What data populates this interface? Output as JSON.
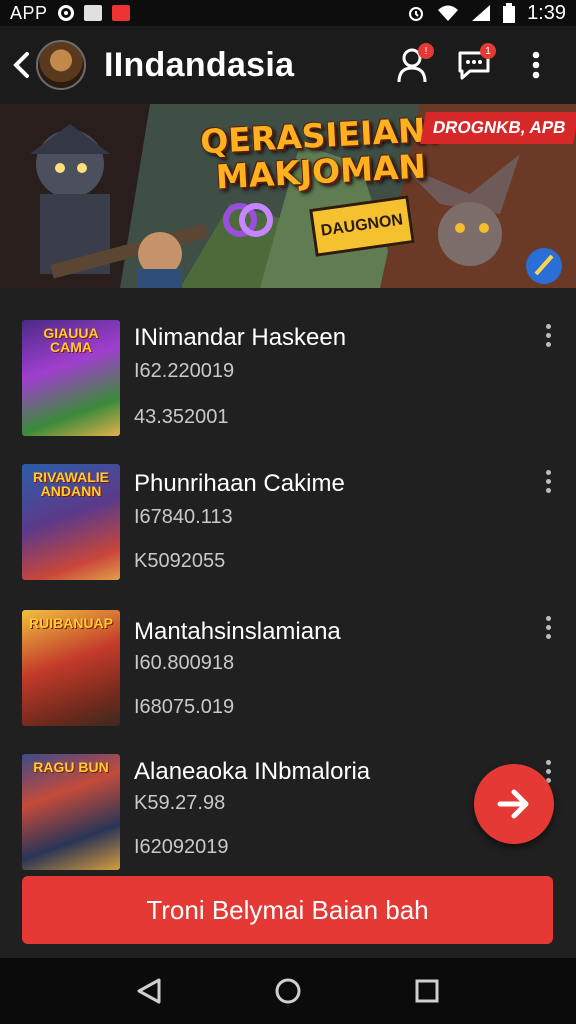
{
  "status_bar": {
    "app_label": "APP",
    "time": "1:39",
    "icons": [
      "record-icon",
      "image-icon",
      "red-app-icon",
      "alarm-icon",
      "wifi-icon",
      "signal-icon",
      "battery-icon"
    ]
  },
  "app_bar": {
    "title": "IIndandasia",
    "icons": [
      "back-icon",
      "avatar",
      "profile-icon",
      "chat-icon",
      "more-vert-icon"
    ],
    "profile_badge": "!",
    "chat_badge": "1"
  },
  "banner": {
    "title": "QERASIEIANI MAKJOMAN",
    "ribbon": "DROGNKB, APB",
    "sticker": "DAUGNON",
    "pages": 3,
    "active_page": 1
  },
  "items": [
    {
      "title": "INimandar Haskeen",
      "line1": "I62.220019",
      "line2": "43.352001",
      "thumb_text": "GIAUUA CAMA"
    },
    {
      "title": "Phunrihaan Cakime",
      "line1": "I67840.113",
      "line2": "K5092055",
      "thumb_text": "RIVAWALIE ANDANN"
    },
    {
      "title": "Mantahsinslamiana",
      "line1": "I60.800918",
      "line2": "I68075.019",
      "thumb_text": "RUIBANUAP"
    },
    {
      "title": "Alaneaoka INbmaloria",
      "line1": "K59.27.98",
      "line2": "I62092019",
      "thumb_text": "RAGU BUN"
    }
  ],
  "cta": {
    "label": "Troni Belymai Baian bah"
  },
  "colors": {
    "accent": "#e53935",
    "background": "#202020",
    "appbar": "#1b1b1b"
  },
  "nav": {
    "icons": [
      "back-triangle-icon",
      "home-circle-icon",
      "recents-square-icon"
    ]
  }
}
